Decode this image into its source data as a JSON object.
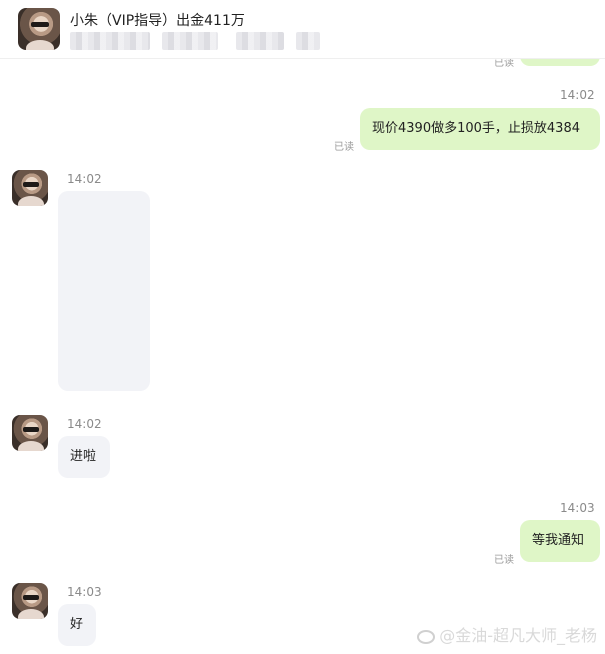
{
  "header": {
    "title": "小朱（VIP指导）出金411万"
  },
  "messages": [
    {
      "time": "14:02",
      "text": "现价4390做多100手，止损放4384",
      "read": "已读",
      "side": "me"
    },
    {
      "time": "14:02",
      "type": "image",
      "side": "other"
    },
    {
      "time": "14:02",
      "text": "进啦",
      "side": "other"
    },
    {
      "time": "14:03",
      "text": "等我通知",
      "read": "已读",
      "side": "me"
    },
    {
      "time": "14:03",
      "text": "好",
      "side": "other"
    }
  ],
  "top_partial": {
    "read": "已读"
  },
  "watermark": "@金油-超凡大师_老杨",
  "colors": {
    "my_bubble": "#dff6c7",
    "other_bubble": "#f2f3f7"
  }
}
